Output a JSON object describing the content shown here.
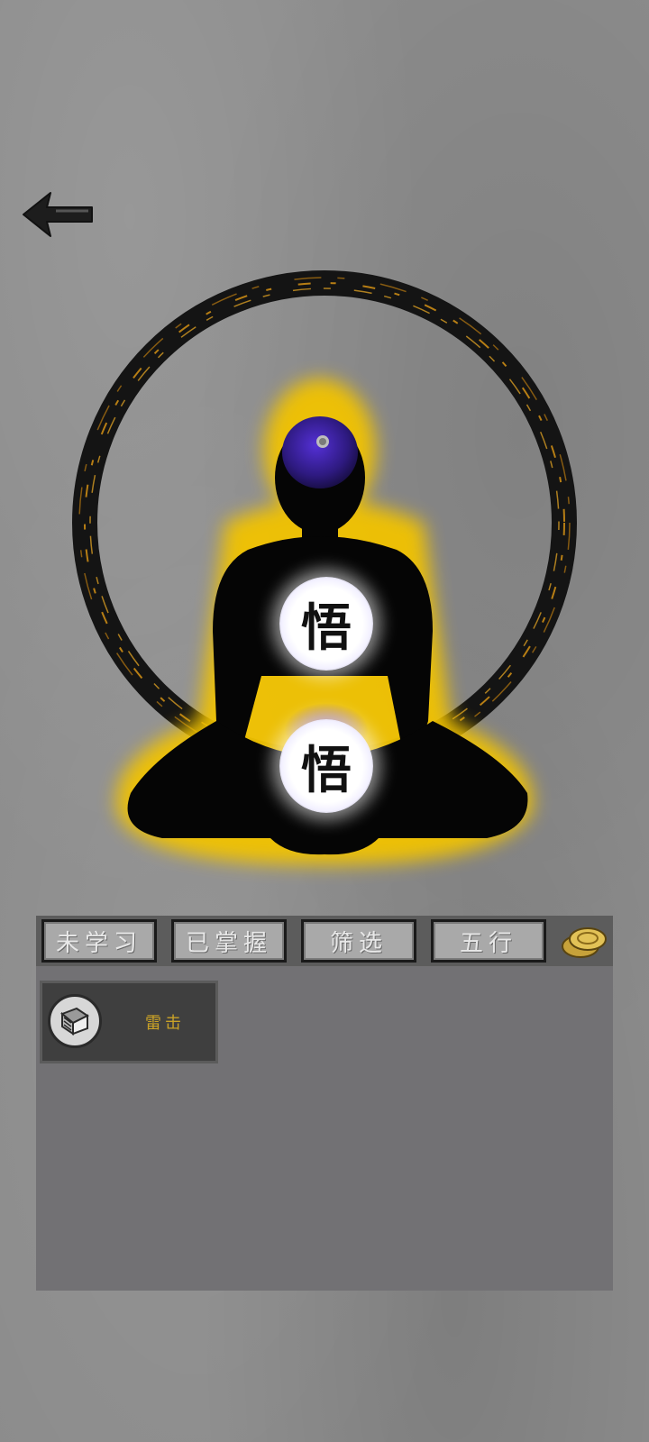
{
  "navigation": {
    "back_icon": "left-arrow-icon"
  },
  "cultivation_figure": {
    "glyph_upper": "悟",
    "glyph_lower": "悟",
    "aura_color": "#f2c300",
    "head_color": "#3a1f9a",
    "ring_accent": "#c98a14"
  },
  "tabs": [
    {
      "label": "未学习"
    },
    {
      "label": "已掌握"
    },
    {
      "label": "筛选"
    },
    {
      "label": "五行"
    }
  ],
  "coins_icon": "gold-coins-icon",
  "skills": [
    {
      "name": "雷击",
      "icon": "book-icon"
    }
  ]
}
